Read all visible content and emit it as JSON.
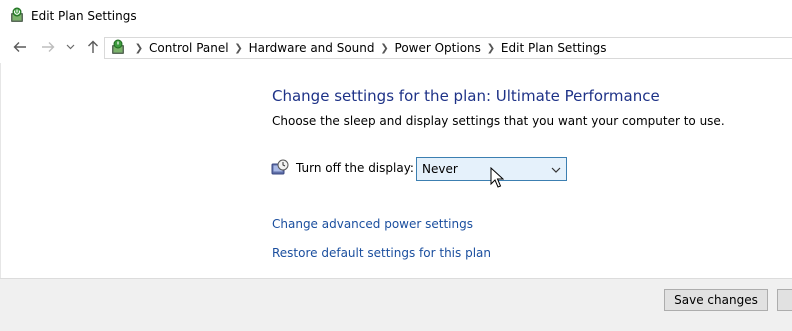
{
  "window": {
    "title": "Edit Plan Settings"
  },
  "navigation": {
    "back_icon": "arrow-left-icon",
    "forward_icon": "arrow-right-icon",
    "recent_icon": "chevron-down-icon",
    "up_icon": "arrow-up-icon"
  },
  "breadcrumb": {
    "items": [
      "Control Panel",
      "Hardware and Sound",
      "Power Options",
      "Edit Plan Settings"
    ]
  },
  "main": {
    "heading": "Change settings for the plan: Ultimate Performance",
    "subheading": "Choose the sleep and display settings that you want your computer to use.",
    "display_setting": {
      "label": "Turn off the display:",
      "selected": "Never"
    },
    "links": {
      "advanced": "Change advanced power settings",
      "restore": "Restore default settings for this plan"
    }
  },
  "footer": {
    "save_label": "Save changes"
  },
  "colors": {
    "heading": "#1e3287",
    "link": "#1a4e9e",
    "select_bg": "#e5f1fb",
    "select_border": "#3c7fb1",
    "footer_bg": "#f0f0f0"
  }
}
